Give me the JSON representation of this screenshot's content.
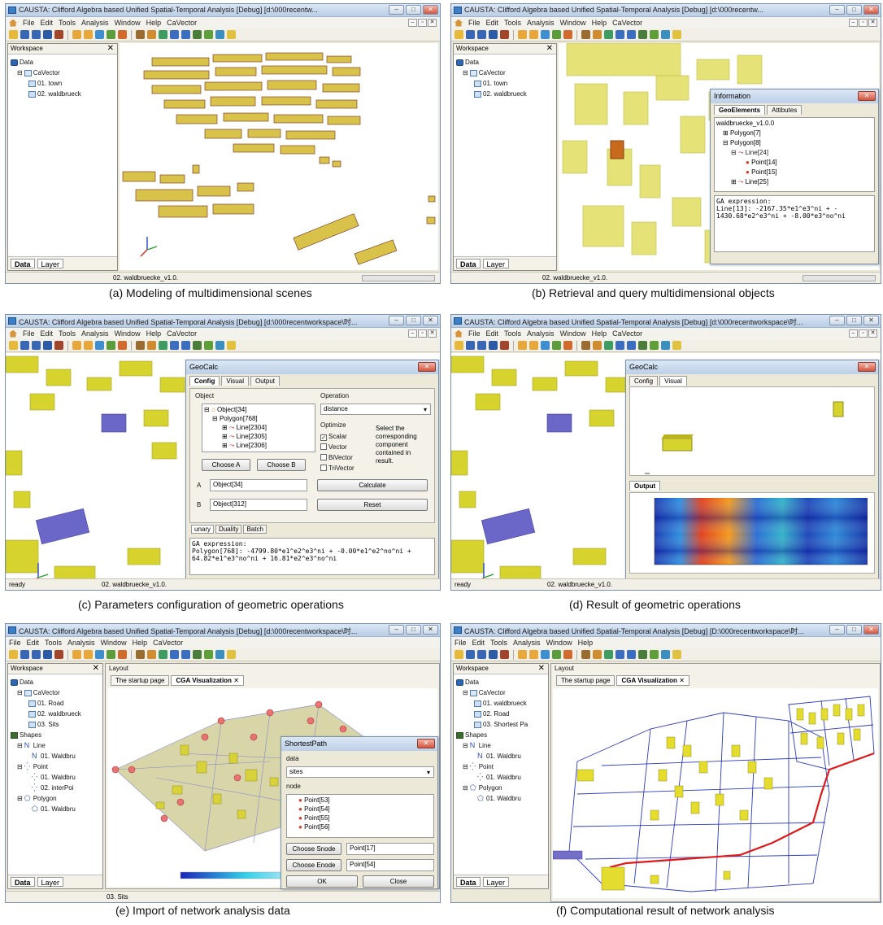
{
  "window": {
    "title": "CAUSTA: Clifford Algebra based Unified Spatial-Temporal Analysis [Debug] [d:\\000recentw...",
    "title_long_c": "CAUSTA: Clifford Algebra based Unified Spatial-Temporal Analysis [Debug] [d:\\000recentworkspace\\时...",
    "title_long_f": "CAUSTA: Clifford Algebra based Unified Spatial-Temporal Analysis [Debug] [D:\\000recentworkspace\\时...",
    "menu": [
      "File",
      "Edit",
      "Tools",
      "Analysis",
      "Window",
      "Help",
      "CaVector"
    ],
    "menu_f": [
      "File",
      "Edit",
      "Tools",
      "Analysis",
      "Window",
      "Help"
    ],
    "toolbar_colors": [
      "#e7b93b",
      "#3867b5",
      "#3867b5",
      "#2b5aa6",
      "#a2452d",
      "#e8a73a",
      "#e8a73a",
      "#3f8fd0",
      "#5b9c3c",
      "#d06b2d",
      "#9b6c2f",
      "#d08c2e",
      "#3e9c62",
      "#3b6ec0",
      "#3b6ec0",
      "#4a7d3c",
      "#5f9f3a",
      "#3a8fbe",
      "#e0c240"
    ]
  },
  "workspace": {
    "header": "Workspace",
    "close": "✕",
    "tabs": {
      "data": "Data",
      "layer": "Layer"
    }
  },
  "panel_a": {
    "caption": "(a) Modeling of multidimensional scenes",
    "tree": [
      "Data",
      "CaVector",
      "01. town",
      "02. waldbrueck"
    ],
    "status": "02. waldbruecke_v1.0."
  },
  "panel_b": {
    "caption": "(b) Retrieval and query multidimensional objects",
    "tree": [
      "Data",
      "CaVector",
      "01. town",
      "02. waldbrueck"
    ],
    "status": "02. waldbruecke_v1.0.",
    "info": {
      "title": "Information",
      "tabs": [
        "GeoElements",
        "Attibutes"
      ],
      "tree": [
        "waldbruecke_v1.0.0",
        "Polygon[7]",
        "Polygon[8]",
        "Line[24]",
        "Point[14]",
        "Point[15]",
        "Line[25]"
      ],
      "expr_label": "GA expression:",
      "expr_lines": [
        "Line[13]: -2167.35*e1^e3^ni + -",
        "1430.68*e2^e3^ni + -8.00*e3^no^ni"
      ]
    }
  },
  "panel_c": {
    "caption": "(c) Parameters configuration of geometric operations",
    "status_left": "ready",
    "status": "02. waldbruecke_v1.0.",
    "geocalc": {
      "title": "GeoCalc",
      "tabs": [
        "Config",
        "Visual",
        "Output"
      ],
      "object_label": "Object",
      "object_tree": [
        "Object[34]",
        "Polygon[768]",
        "Line[2304]",
        "Line[2305]",
        "Line[2306]"
      ],
      "operation_label": "Operation",
      "operation_value": "distance",
      "optimize_label": "Optimize",
      "options": [
        "Scalar",
        "Vector",
        "BiVector",
        "TriVector"
      ],
      "hint": [
        "Select the",
        "corresponding",
        "component",
        "contained in",
        "result."
      ],
      "choose_a": "Choose A",
      "choose_b": "Choose B",
      "a_label": "A",
      "a_value": "Object[34]",
      "b_label": "B",
      "b_value": "Object[312]",
      "calculate": "Calculate",
      "reset": "Reset",
      "bottom_tabs": [
        "unary",
        "Duality",
        "Batch"
      ],
      "expr_label": "GA expression:",
      "expr_lines": [
        "Polygon[768]: -4799.80*e1^e2^e3^ni + -0.00*e1^e2^no^ni +",
        "64.82*e1^e3^no^ni + 16.81*e2^e3^no^ni"
      ]
    }
  },
  "panel_d": {
    "caption": "(d) Result of geometric operations",
    "status_left": "ready",
    "status": "02. waldbruecke_v1.0.",
    "geocalc": {
      "title": "GeoCalc",
      "tabs": [
        "Config",
        "Visual"
      ],
      "output_tab": "Output"
    }
  },
  "panel_e": {
    "caption": "(e) Import of network analysis data",
    "tree": [
      "Data",
      "CaVector",
      "01. Road",
      "02. waldbrueck",
      "03. Sits",
      "Shapes",
      "Line",
      "01. Waldbru",
      "Point",
      "01. Waldbru",
      "02. interPoi",
      "Polygon",
      "01. Waldbru"
    ],
    "layout_label": "Layout",
    "tabs": [
      "The startup page",
      "CGA Visualization"
    ],
    "status": "03. Sits",
    "shortest": {
      "title": "ShortestPath",
      "data_label": "data",
      "data_value": "sites",
      "node_label": "node",
      "nodes": [
        "Point[53]",
        "Point[54]",
        "Point[55]",
        "Point[56]"
      ],
      "snode_btn": "Choose Snode",
      "snode_value": "Point[17]",
      "enode_btn": "Choose Enode",
      "enode_value": "Point[54]",
      "ok": "OK",
      "close": "Close"
    }
  },
  "panel_f": {
    "caption": "(f) Computational result of network analysis",
    "tree": [
      "Data",
      "CaVector",
      "01. waldbrueck",
      "02. Road",
      "03. Shortest Pa",
      "Shapes",
      "Line",
      "01. Waldbru",
      "Point",
      "01. Waldbru",
      "Polygon",
      "01. Waldbru"
    ],
    "layout_label": "Layout",
    "tabs": [
      "The startup page",
      "CGA Visualization"
    ]
  }
}
